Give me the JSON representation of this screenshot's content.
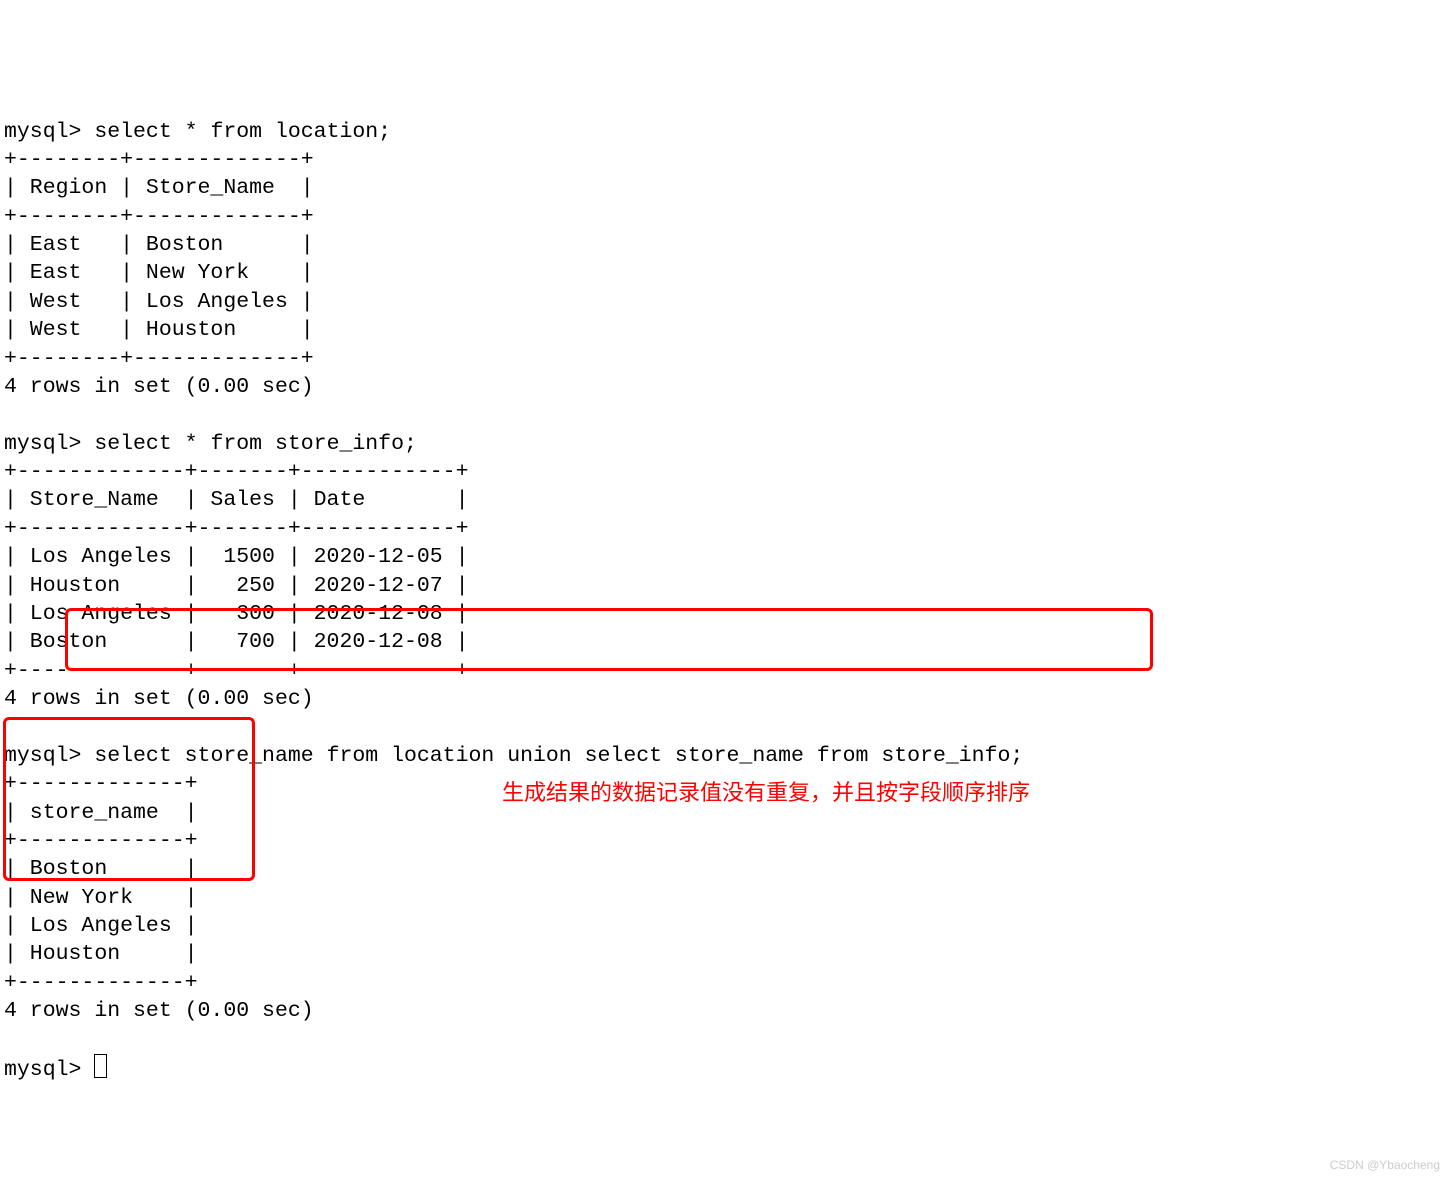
{
  "prompt": "mysql> ",
  "queries": {
    "q1": "select * from location;",
    "q2": "select * from store_info;",
    "q3": "select store_name from location union select store_name from store_info;"
  },
  "location_table": {
    "border_top": "+--------+-------------+",
    "header": "| Region | Store_Name  |",
    "rows": [
      "| East   | Boston      |",
      "| East   | New York    |",
      "| West   | Los Angeles |",
      "| West   | Houston     |"
    ],
    "footer": "4 rows in set (0.00 sec)"
  },
  "store_info_table": {
    "border_top": "+-------------+-------+------------+",
    "header": "| Store_Name  | Sales | Date       |",
    "rows": [
      "| Los Angeles |  1500 | 2020-12-05 |",
      "| Houston     |   250 | 2020-12-07 |",
      "| Los Angeles |   300 | 2020-12-08 |",
      "| Boston      |   700 | 2020-12-08 |"
    ],
    "footer": "4 rows in set (0.00 sec)"
  },
  "union_table": {
    "border_top": "+-------------+",
    "header": "| store_name  |",
    "rows": [
      "| Boston      |",
      "| New York    |",
      "| Los Angeles |",
      "| Houston     |"
    ],
    "footer": "4 rows in set (0.00 sec)"
  },
  "annotation": "生成结果的数据记录值没有重复，并且按字段顺序排序",
  "watermark": "CSDN @Ybaocheng"
}
